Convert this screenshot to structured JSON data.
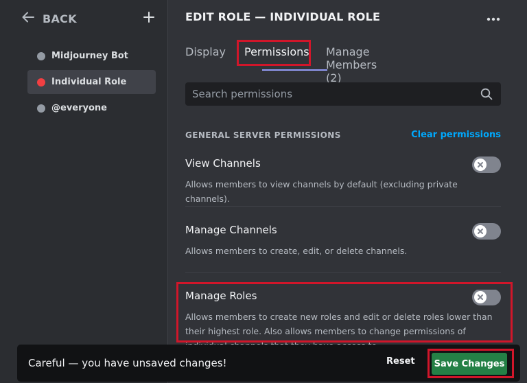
{
  "sidebar": {
    "back_label": "BACK",
    "roles": [
      {
        "label": "Midjourney Bot",
        "color": "#949ba4",
        "selected": false
      },
      {
        "label": "Individual Role",
        "color": "#f23f42",
        "selected": true
      },
      {
        "label": "@everyone",
        "color": "#949ba4",
        "selected": false
      }
    ]
  },
  "header": {
    "title": "EDIT ROLE — INDIVIDUAL ROLE"
  },
  "tabs": [
    {
      "label": "Display"
    },
    {
      "label": "Permissions"
    },
    {
      "label": "Manage Members (2)"
    }
  ],
  "search": {
    "placeholder": "Search permissions"
  },
  "section": {
    "title": "GENERAL SERVER PERMISSIONS",
    "clear_label": "Clear permissions"
  },
  "permissions": [
    {
      "title": "View Channels",
      "description": "Allows members to view channels by default (excluding private channels).",
      "enabled": false
    },
    {
      "title": "Manage Channels",
      "description": "Allows members to create, edit, or delete channels.",
      "enabled": false
    },
    {
      "title": "Manage Roles",
      "description": "Allows members to create new roles and edit or delete roles lower than their highest role. Also allows members to change permissions of individual channels that they have access to.",
      "enabled": false
    }
  ],
  "notice": {
    "text": "Careful — you have unsaved changes!",
    "reset_label": "Reset",
    "save_label": "Save Changes"
  },
  "colors": {
    "accent": "#949cf7",
    "highlight": "#d1162a",
    "save": "#248046",
    "link": "#00a8fc"
  }
}
